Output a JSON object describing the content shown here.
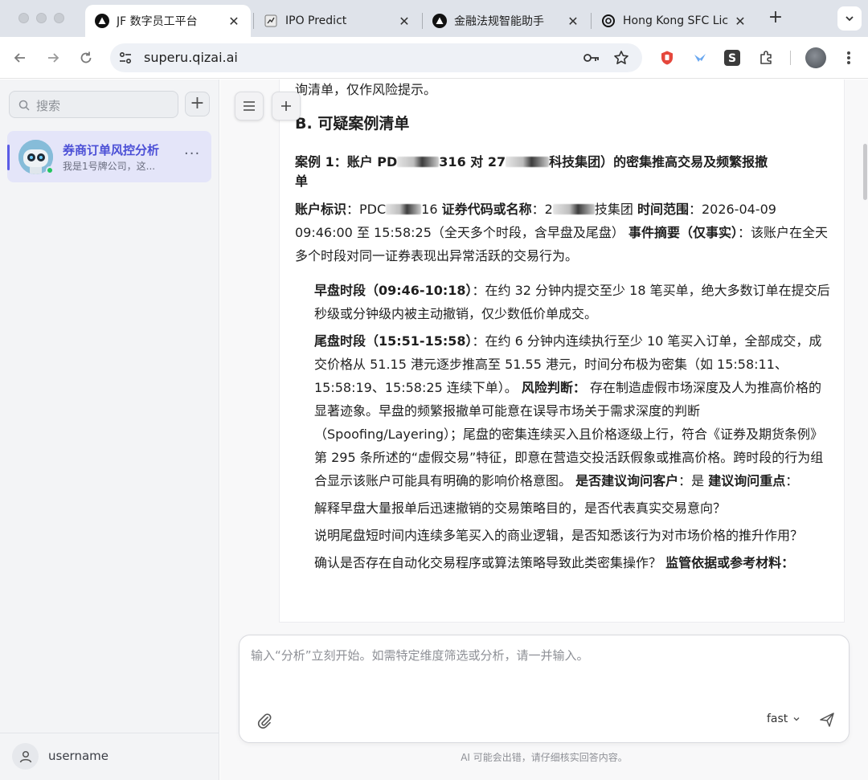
{
  "browser": {
    "tabs": [
      {
        "title": "JF 数字员工平台",
        "active": true
      },
      {
        "title": "IPO Predict",
        "active": false
      },
      {
        "title": "金融法规智能助手",
        "active": false
      },
      {
        "title": "Hong Kong SFC Lice",
        "active": false
      }
    ],
    "close_glyph": "✕",
    "new_tab_glyph": "+",
    "url": "superu.qizai.ai"
  },
  "sidebar": {
    "search_placeholder": "搜索",
    "add_glyph": "+",
    "conversation": {
      "title": "券商订单风控分析",
      "subtitle": "我是1号牌公司，这...",
      "more": "···"
    },
    "username": "username"
  },
  "message": {
    "intro_tail": "询清单，仅作风险提示。",
    "section_title": "B. 可疑案例清单",
    "case_heading_parts": [
      "案例 1：账户 PD",
      "316 对 27",
      "科技集团）的密集推高交易及频繁报撤",
      "单"
    ],
    "meta": {
      "account_label": "账户标识",
      "account_value_a": "：PDC",
      "account_value_b": "16",
      "code_label": "证券代码或名称",
      "code_value_a": "：2",
      "code_value_b": "技集团",
      "time_label": "时间范围",
      "time_value": "：2026-04-09 09:46:00 至 15:58:25（全天多个时段，含早盘及尾盘）",
      "summary_label": "事件摘要（仅事实）",
      "summary_value": "：该账户在全天多个时段对同一证券表现出异常活跃的交易行为。"
    },
    "morning_label": "早盘时段（09:46-10:18）",
    "morning_text": "：在约 32 分钟内提交至少 18 笔买单，绝大多数订单在提交后秒级或分钟级内被主动撤销，仅少数低价单成交。",
    "closing_label": "尾盘时段（15:51-15:58）",
    "closing_text": "：在约 6 分钟内连续执行至少 10 笔买入订单，全部成交，成交价格从 51.15 港元逐步推高至 51.55 港元，时间分布极为密集（如 15:58:11、15:58:19、15:58:25 连续下单）。",
    "risk_label": "风险判断：",
    "risk_text": " 存在制造虚假市场深度及人为推高价格的显著迹象。早盘的频繁报撤单可能意在误导市场关于需求深度的判断（Spoofing/Layering）；尾盘的密集连续买入且价格逐级上行，符合《证券及期货条例》第 295 条所述的“虚假交易”特征，即意在营造交投活跃假象或推高价格。跨时段的行为组合显示该账户可能具有明确的影响价格意图。",
    "inquiry_label": "是否建议询问客户",
    "inquiry_value": "：是",
    "focus_label": "建议询问重点",
    "focus_colon": "：",
    "questions": [
      "解释早盘大量报单后迅速撤销的交易策略目的，是否代表真实交易意向？",
      "说明尾盘短时间内连续多笔买入的商业逻辑，是否知悉该行为对市场价格的推升作用？",
      "确认是否存在自动化交易程序或算法策略导致此类密集操作？"
    ],
    "cut_label": "监管依据或参考材料："
  },
  "composer": {
    "placeholder": "输入“分析”立刻开始。如需特定维度筛选或分析，请一并输入。",
    "model": "fast"
  },
  "disclaimer": "AI 可能会出错，请仔细核实回答内容。"
}
